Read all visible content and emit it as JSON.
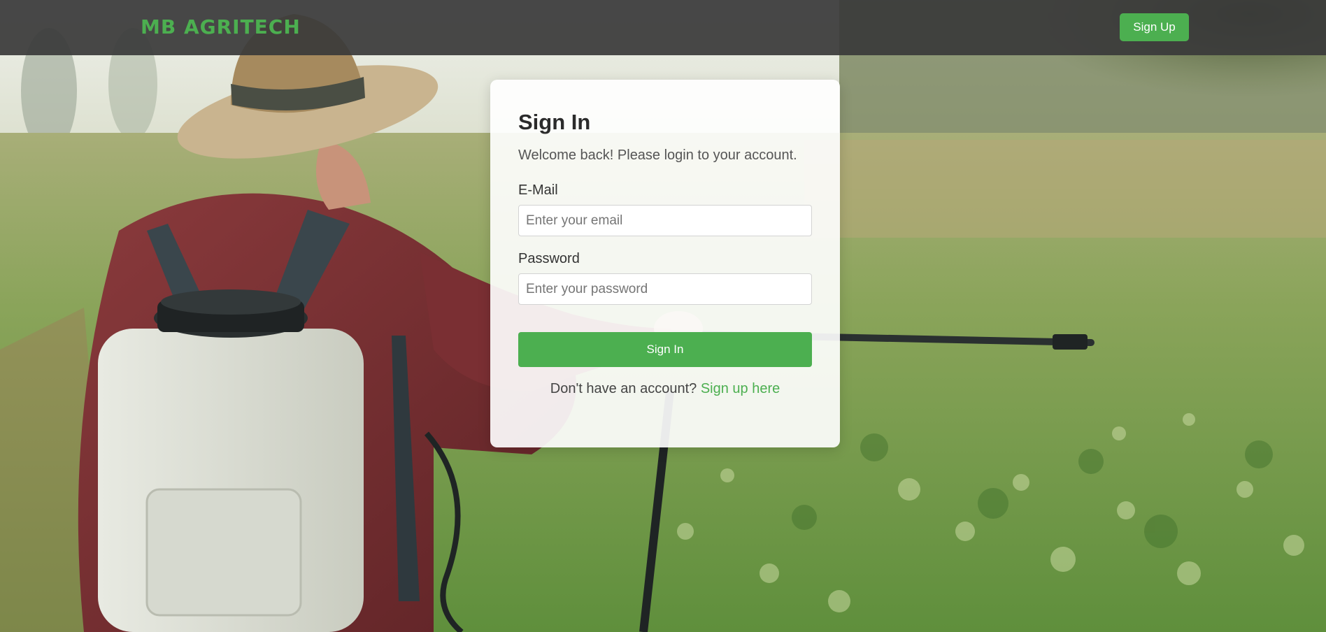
{
  "header": {
    "logo_text": "MB AGRITECH",
    "signup_label": "Sign Up"
  },
  "login": {
    "title": "Sign In",
    "subtitle": "Welcome back! Please login to your account.",
    "email_label": "E-Mail",
    "email_placeholder": "Enter your email",
    "email_value": "",
    "password_label": "Password",
    "password_placeholder": "Enter your password",
    "password_value": "",
    "submit_label": "Sign In",
    "no_account_text": "Don't have an account?",
    "signup_link_label": "Sign up here"
  },
  "colors": {
    "brand_green": "#4caf50",
    "header_bg": "#3a3a3a",
    "card_bg": "#ffffff"
  }
}
